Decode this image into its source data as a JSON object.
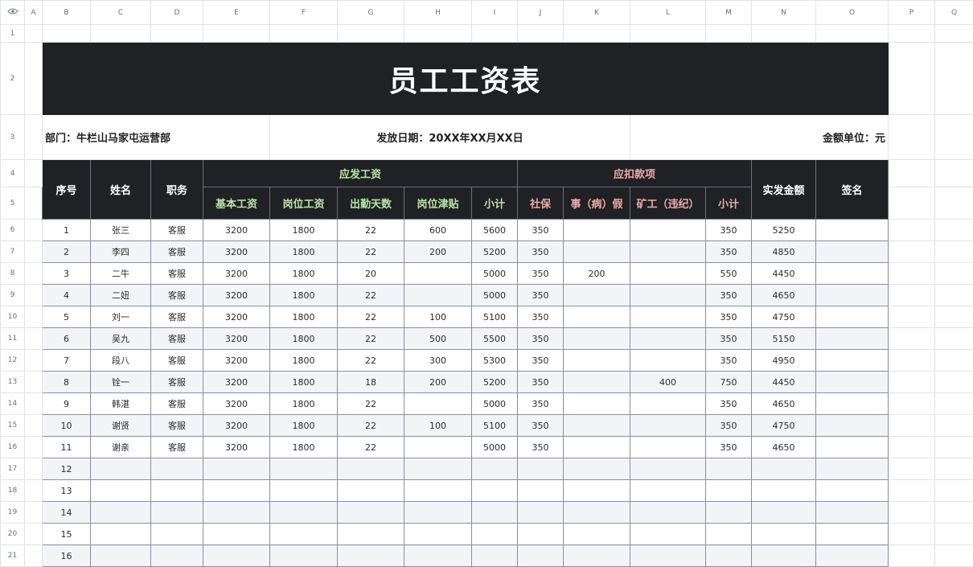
{
  "sheet": {
    "eye_icon": "eye-icon",
    "columns": [
      "A",
      "B",
      "C",
      "D",
      "E",
      "F",
      "G",
      "H",
      "I",
      "J",
      "K",
      "L",
      "M",
      "N",
      "O",
      "P",
      "Q"
    ],
    "row_numbers": [
      "1",
      "2",
      "3",
      "4",
      "5",
      "6",
      "7",
      "8",
      "9",
      "10",
      "11",
      "12",
      "13",
      "14",
      "15",
      "16",
      "17",
      "18",
      "19",
      "20",
      "21"
    ],
    "title": "员工工资表",
    "department": "部门：牛栏山马家屯运营部",
    "issue_date": "发放日期：20XX年XX月XX日",
    "unit": "金额单位：元",
    "headers": {
      "index": "序号",
      "name": "姓名",
      "role": "职务",
      "payable_group": "应发工资",
      "deduction_group": "应扣款项",
      "net": "实发金额",
      "sign": "签名",
      "basic": "基本工资",
      "post": "岗位工资",
      "days": "出勤天数",
      "allowance": "岗位津贴",
      "subtotal_pay": "小计",
      "social": "社保",
      "leave": "事（病）假",
      "absence": "矿工（违纪）",
      "subtotal_deduct": "小计"
    },
    "rows": [
      {
        "index": "1",
        "name": "张三",
        "role": "客服",
        "basic": "3200",
        "post": "1800",
        "days": "22",
        "allowance": "600",
        "subtotal_pay": "5600",
        "social": "350",
        "leave": "",
        "absence": "",
        "subtotal_deduct": "350",
        "net": "5250",
        "sign": ""
      },
      {
        "index": "2",
        "name": "李四",
        "role": "客服",
        "basic": "3200",
        "post": "1800",
        "days": "22",
        "allowance": "200",
        "subtotal_pay": "5200",
        "social": "350",
        "leave": "",
        "absence": "",
        "subtotal_deduct": "350",
        "net": "4850",
        "sign": ""
      },
      {
        "index": "3",
        "name": "二牛",
        "role": "客服",
        "basic": "3200",
        "post": "1800",
        "days": "20",
        "allowance": "",
        "subtotal_pay": "5000",
        "social": "350",
        "leave": "200",
        "absence": "",
        "subtotal_deduct": "550",
        "net": "4450",
        "sign": ""
      },
      {
        "index": "4",
        "name": "二妞",
        "role": "客服",
        "basic": "3200",
        "post": "1800",
        "days": "22",
        "allowance": "",
        "subtotal_pay": "5000",
        "social": "350",
        "leave": "",
        "absence": "",
        "subtotal_deduct": "350",
        "net": "4650",
        "sign": ""
      },
      {
        "index": "5",
        "name": "刘一",
        "role": "客服",
        "basic": "3200",
        "post": "1800",
        "days": "22",
        "allowance": "100",
        "subtotal_pay": "5100",
        "social": "350",
        "leave": "",
        "absence": "",
        "subtotal_deduct": "350",
        "net": "4750",
        "sign": ""
      },
      {
        "index": "6",
        "name": "吴九",
        "role": "客服",
        "basic": "3200",
        "post": "1800",
        "days": "22",
        "allowance": "500",
        "subtotal_pay": "5500",
        "social": "350",
        "leave": "",
        "absence": "",
        "subtotal_deduct": "350",
        "net": "5150",
        "sign": ""
      },
      {
        "index": "7",
        "name": "段八",
        "role": "客服",
        "basic": "3200",
        "post": "1800",
        "days": "22",
        "allowance": "300",
        "subtotal_pay": "5300",
        "social": "350",
        "leave": "",
        "absence": "",
        "subtotal_deduct": "350",
        "net": "4950",
        "sign": ""
      },
      {
        "index": "8",
        "name": "铨一",
        "role": "客服",
        "basic": "3200",
        "post": "1800",
        "days": "18",
        "allowance": "200",
        "subtotal_pay": "5200",
        "social": "350",
        "leave": "",
        "absence": "400",
        "subtotal_deduct": "750",
        "net": "4450",
        "sign": ""
      },
      {
        "index": "9",
        "name": "韩湛",
        "role": "客服",
        "basic": "3200",
        "post": "1800",
        "days": "22",
        "allowance": "",
        "subtotal_pay": "5000",
        "social": "350",
        "leave": "",
        "absence": "",
        "subtotal_deduct": "350",
        "net": "4650",
        "sign": ""
      },
      {
        "index": "10",
        "name": "谢贤",
        "role": "客服",
        "basic": "3200",
        "post": "1800",
        "days": "22",
        "allowance": "100",
        "subtotal_pay": "5100",
        "social": "350",
        "leave": "",
        "absence": "",
        "subtotal_deduct": "350",
        "net": "4750",
        "sign": ""
      },
      {
        "index": "11",
        "name": "谢亲",
        "role": "客服",
        "basic": "3200",
        "post": "1800",
        "days": "22",
        "allowance": "",
        "subtotal_pay": "5000",
        "social": "350",
        "leave": "",
        "absence": "",
        "subtotal_deduct": "350",
        "net": "4650",
        "sign": ""
      },
      {
        "index": "12",
        "name": "",
        "role": "",
        "basic": "",
        "post": "",
        "days": "",
        "allowance": "",
        "subtotal_pay": "",
        "social": "",
        "leave": "",
        "absence": "",
        "subtotal_deduct": "",
        "net": "",
        "sign": ""
      },
      {
        "index": "13",
        "name": "",
        "role": "",
        "basic": "",
        "post": "",
        "days": "",
        "allowance": "",
        "subtotal_pay": "",
        "social": "",
        "leave": "",
        "absence": "",
        "subtotal_deduct": "",
        "net": "",
        "sign": ""
      },
      {
        "index": "14",
        "name": "",
        "role": "",
        "basic": "",
        "post": "",
        "days": "",
        "allowance": "",
        "subtotal_pay": "",
        "social": "",
        "leave": "",
        "absence": "",
        "subtotal_deduct": "",
        "net": "",
        "sign": ""
      },
      {
        "index": "15",
        "name": "",
        "role": "",
        "basic": "",
        "post": "",
        "days": "",
        "allowance": "",
        "subtotal_pay": "",
        "social": "",
        "leave": "",
        "absence": "",
        "subtotal_deduct": "",
        "net": "",
        "sign": ""
      },
      {
        "index": "16",
        "name": "",
        "role": "",
        "basic": "",
        "post": "",
        "days": "",
        "allowance": "",
        "subtotal_pay": "",
        "social": "",
        "leave": "",
        "absence": "",
        "subtotal_deduct": "",
        "net": "",
        "sign": ""
      }
    ],
    "colors": {
      "header_bg": "#1f2124",
      "payable_text": "#b8e6a6",
      "deduction_text": "#f2a9a6",
      "alt_row_bg": "#f3f4f7"
    }
  }
}
